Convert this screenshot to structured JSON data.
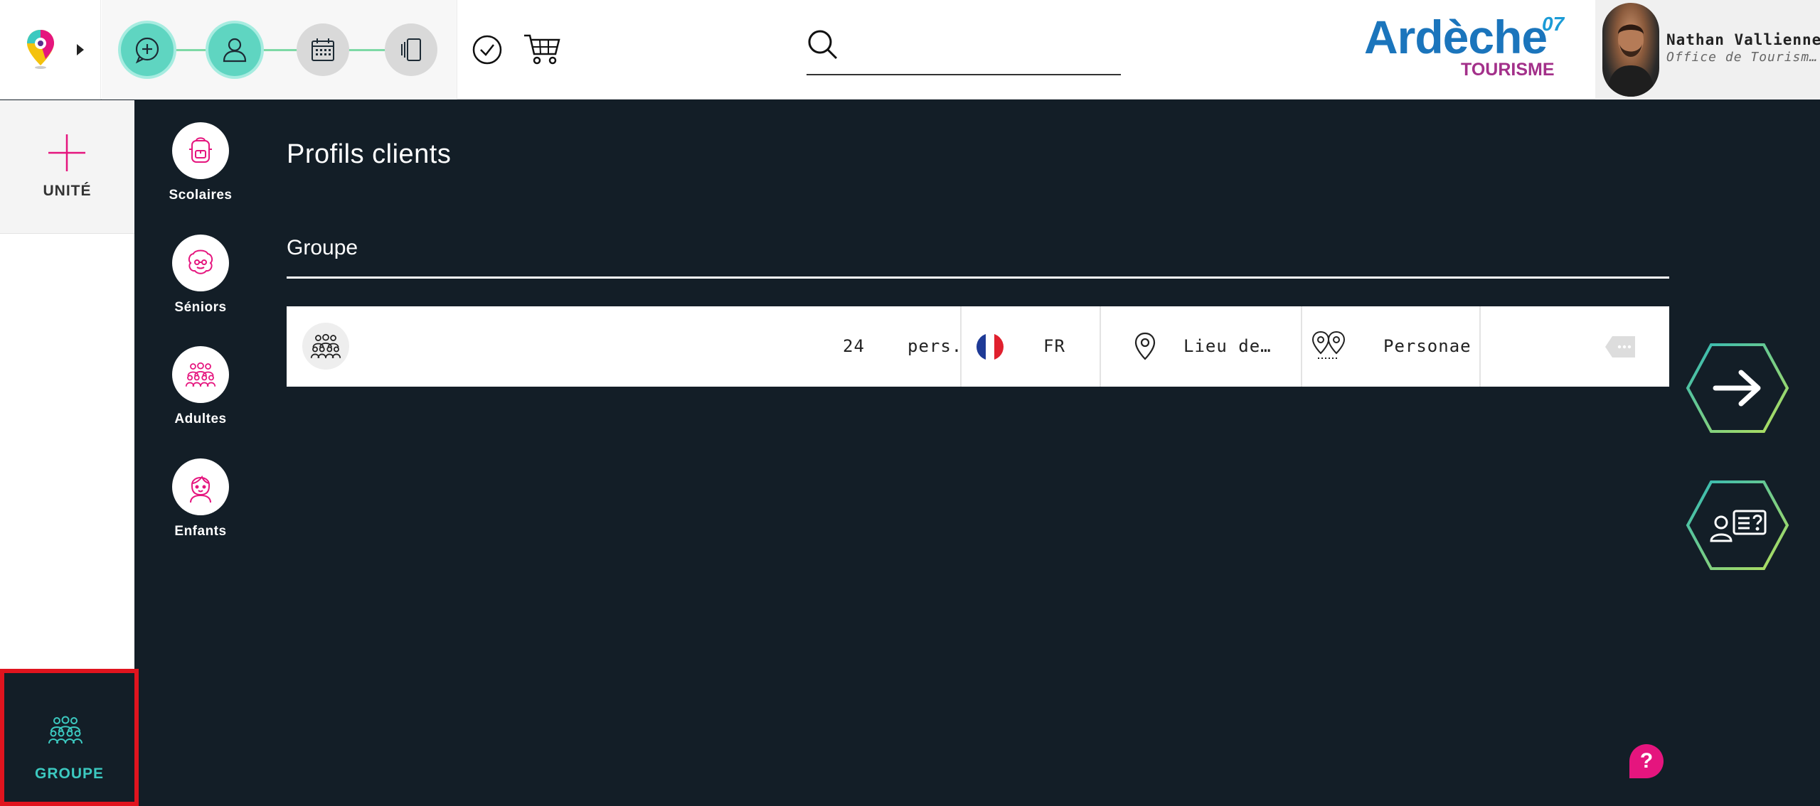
{
  "header": {
    "steps": [
      {
        "name": "add",
        "state": "done"
      },
      {
        "name": "profile",
        "state": "done"
      },
      {
        "name": "calendar",
        "state": "todo"
      },
      {
        "name": "offers",
        "state": "todo"
      }
    ],
    "search": {
      "placeholder": "",
      "value": ""
    },
    "brand": {
      "name": "Ardèche",
      "number": "07",
      "subtitle": "TOURISME"
    },
    "user": {
      "name": "Nathan Vallienne",
      "organization": "Office de Tourisme Ardèche"
    }
  },
  "sidebar": {
    "unit_label": "UNITÉ",
    "groupe_label": "GROUPE"
  },
  "categories": [
    {
      "label": "Scolaires",
      "icon": "backpack-icon"
    },
    {
      "label": "Séniors",
      "icon": "senior-icon"
    },
    {
      "label": "Adultes",
      "icon": "group-icon"
    },
    {
      "label": "Enfants",
      "icon": "child-icon"
    }
  ],
  "main": {
    "title": "Profils clients",
    "section_title": "Groupe",
    "row": {
      "count": "24",
      "unit": "pers.",
      "language": "FR",
      "place": "Lieu de résidence",
      "persona": "Personae"
    }
  },
  "help_label": "?",
  "colors": {
    "accent_teal": "#5fd5c1",
    "brand_blue": "#1b75bc",
    "brand_purple": "#a3308a",
    "dark_bg": "#131e27",
    "help_pink": "#e5157e",
    "highlight_red": "#e0141e"
  }
}
